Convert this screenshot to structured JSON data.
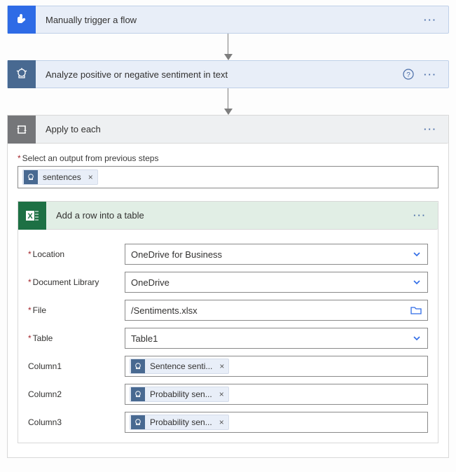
{
  "trigger": {
    "title": "Manually trigger a flow"
  },
  "ai": {
    "title": "Analyze positive or negative sentiment in text"
  },
  "loop": {
    "title": "Apply to each",
    "outputLabel": "Select an output from previous steps",
    "outputToken": "sentences"
  },
  "excel": {
    "title": "Add a row into a table",
    "fields": {
      "location": {
        "label": "Location",
        "value": "OneDrive for Business"
      },
      "library": {
        "label": "Document Library",
        "value": "OneDrive"
      },
      "file": {
        "label": "File",
        "value": "/Sentiments.xlsx"
      },
      "table": {
        "label": "Table",
        "value": "Table1"
      },
      "col1": {
        "label": "Column1",
        "token": "Sentence senti..."
      },
      "col2": {
        "label": "Column2",
        "token": "Probability sen..."
      },
      "col3": {
        "label": "Column3",
        "token": "Probability sen..."
      }
    }
  }
}
